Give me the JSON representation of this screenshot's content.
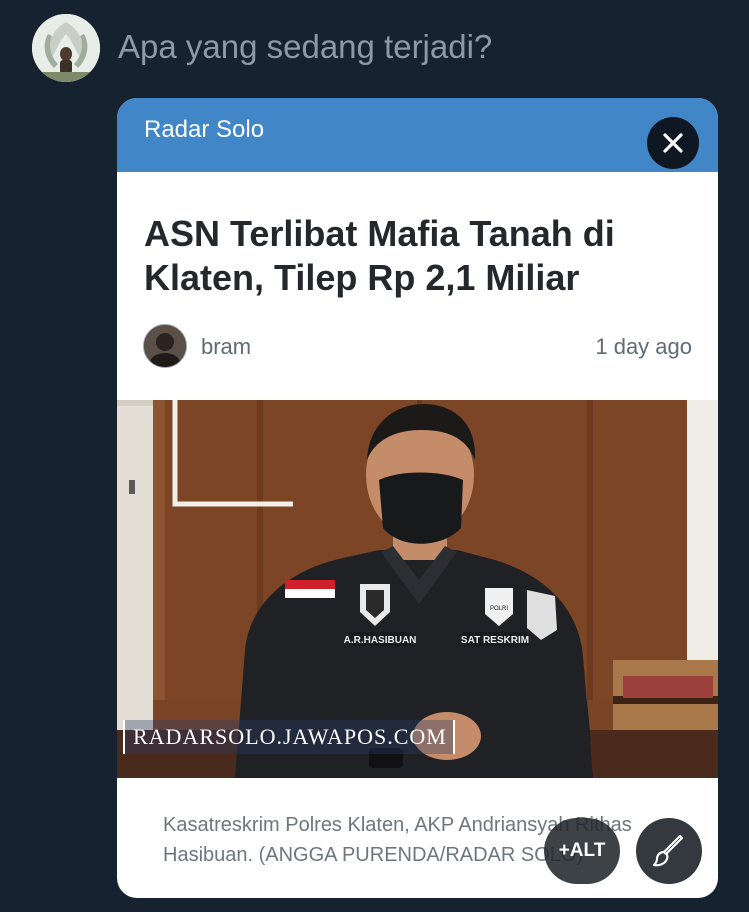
{
  "compose": {
    "placeholder": "Apa yang sedang terjadi?"
  },
  "card": {
    "source": "Radar Solo",
    "title": "ASN Terlibat Mafia Tanah di Klaten, Tilep Rp 2,1 Miliar",
    "author": "bram",
    "time": "1 day ago",
    "watermark": "RADARSOLO.JAWAPOS.COM",
    "badges": {
      "name_tag": "A.R.HASIBUAN",
      "unit_tag": "SAT RESKRIM",
      "badge_text": "POLRI"
    },
    "caption": "Kasatreskrim Polres Klaten, AKP Andriansyah Rithas Hasibuan. (ANGGA PURENDA/RADAR SOLO)"
  },
  "media_actions": {
    "alt_label": "+ALT"
  },
  "colors": {
    "background": "#172230",
    "header_blue": "#4187c7",
    "placeholder": "#8c99a6",
    "dark_button": "#0f1822"
  },
  "icons": {
    "close": "close-icon",
    "edit": "paintbrush-icon"
  }
}
